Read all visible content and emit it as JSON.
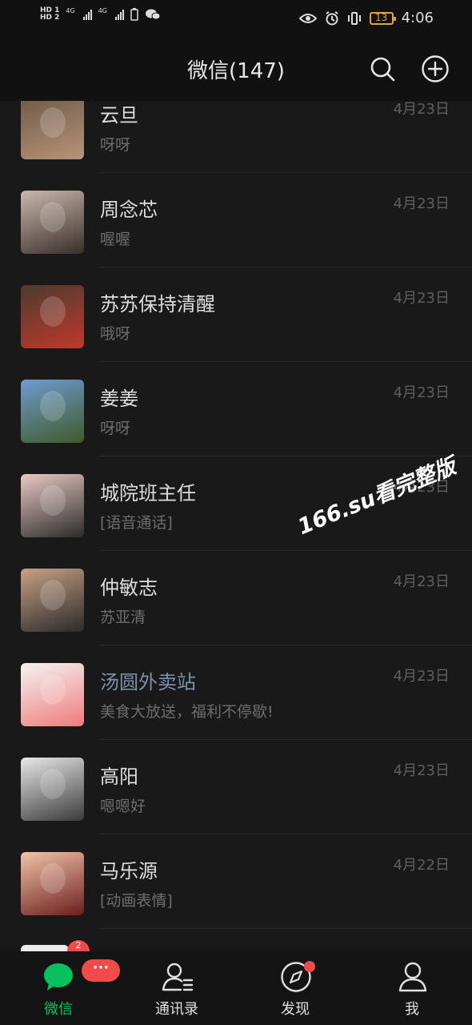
{
  "status_bar": {
    "sim1": "HD 1",
    "sim2": "HD 2",
    "network": "4G",
    "battery": "13",
    "time": "4:06"
  },
  "header": {
    "title": "微信(147)",
    "icons": [
      "search-icon",
      "add-circle-icon"
    ]
  },
  "chats": [
    {
      "name": "云旦",
      "preview": "呀呀",
      "date": "4月23日",
      "avatar_colors": [
        "#6d5a48",
        "#b89478"
      ]
    },
    {
      "name": "周念芯",
      "preview": "喔喔",
      "date": "4月23日",
      "avatar_colors": [
        "#c9b8ad",
        "#3a2e2a"
      ]
    },
    {
      "name": "苏苏保持清醒",
      "preview": "哦呀",
      "date": "4月23日",
      "avatar_colors": [
        "#4b3a30",
        "#c0392b"
      ]
    },
    {
      "name": "姜姜",
      "preview": "呀呀",
      "date": "4月23日",
      "avatar_colors": [
        "#6f9bd1",
        "#3f5a2a"
      ]
    },
    {
      "name": "城院班主任",
      "preview": "[语音通话]",
      "date": "4月23日",
      "avatar_colors": [
        "#e9c9c4",
        "#2b2b2b"
      ]
    },
    {
      "name": "仲敏志",
      "preview": "苏亚清",
      "date": "4月23日",
      "avatar_colors": [
        "#c8a184",
        "#2a2a2a"
      ]
    },
    {
      "name": "汤圆外卖站",
      "preview": "美食大放送，福利不停歇!",
      "date": "4月23日",
      "name_color": "#7d90a9",
      "avatar_colors": [
        "#f4f4f4",
        "#f07a7a"
      ]
    },
    {
      "name": "高阳",
      "preview": "嗯嗯好",
      "date": "4月23日",
      "avatar_colors": [
        "#e8e8e8",
        "#3a3a3a"
      ]
    },
    {
      "name": "马乐源",
      "preview": "[动画表情]",
      "date": "4月22日",
      "avatar_colors": [
        "#f2c4a8",
        "#6b1e1e"
      ]
    }
  ],
  "watermark": "166.su看完整版",
  "tabbar": {
    "tabs": [
      {
        "label": "微信",
        "icon": "chat-icon",
        "active": true,
        "badge": "···"
      },
      {
        "label": "通讯录",
        "icon": "contacts-icon",
        "active": false
      },
      {
        "label": "发现",
        "icon": "compass-icon",
        "active": false,
        "dot": true
      },
      {
        "label": "我",
        "icon": "profile-icon",
        "active": false
      }
    ],
    "active_color": "#07c160",
    "badge_color": "#f04a4a",
    "peek_badge": "2"
  }
}
